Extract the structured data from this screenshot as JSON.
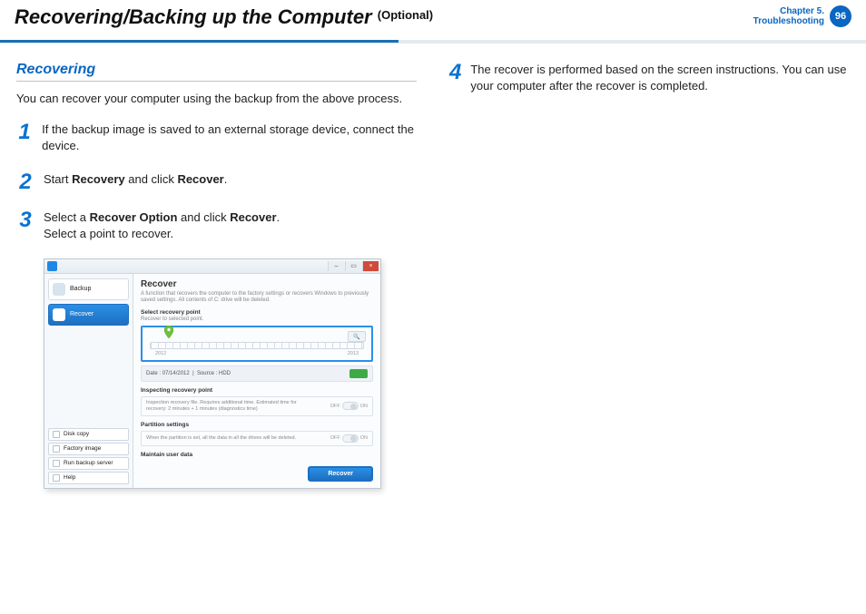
{
  "header": {
    "title": "Recovering/Backing up the Computer",
    "optional": "(Optional)",
    "chapter_line1": "Chapter 5.",
    "chapter_line2": "Troubleshooting",
    "page_number": "96"
  },
  "left": {
    "section_heading": "Recovering",
    "intro": "You can recover your computer using the backup from the above process.",
    "steps": {
      "s1": {
        "num": "1",
        "text": "If the backup image is saved to an external storage device, connect the device."
      },
      "s2": {
        "num": "2",
        "pre": "Start ",
        "b1": "Recovery",
        "mid": " and click ",
        "b2": "Recover",
        "post": "."
      },
      "s3": {
        "num": "3",
        "pre": "Select a ",
        "b1": "Recover Option",
        "mid": " and click ",
        "b2": "Recover",
        "post": ".",
        "line2": "Select a point to recover."
      }
    }
  },
  "right": {
    "s4": {
      "num": "4",
      "line1": "The recover is performed based on the screen instructions.",
      "line2": "You can use your computer after the recover is completed."
    }
  },
  "shot": {
    "window": {
      "min": "–",
      "max": "▭",
      "close": "×"
    },
    "side": {
      "backup": "Backup",
      "recover": "Recover",
      "disk_copy": "Disk copy",
      "factory_image": "Factory image",
      "run_backup_server": "Run backup server",
      "help": "Help"
    },
    "main": {
      "title": "Recover",
      "desc": "A function that recovers the computer to the factory settings or recovers Windows to previously saved settings. All contents of C: drive will be deleted.",
      "select_point_h": "Select recovery point",
      "select_point_d": "Recover to selected point.",
      "year_a": "2012",
      "year_b": "2013",
      "date_label": "Date :",
      "date_val": "07/14/2012",
      "sep": "|",
      "source_label": "Source :",
      "source_val": "HDD",
      "inspect_h": "Inspecting recovery point",
      "inspect_d": "Inspection recovery file. Requires additional time. Estimated time for recovery: 2 minutes + 1 minutes (diagnostics time)",
      "partition_h": "Partition settings",
      "partition_d": "When the partition is set, all the data in all the drives will be deleted.",
      "maintain_h": "Maintain user data",
      "off": "OFF",
      "on": "ON",
      "recover_btn": "Recover"
    }
  }
}
